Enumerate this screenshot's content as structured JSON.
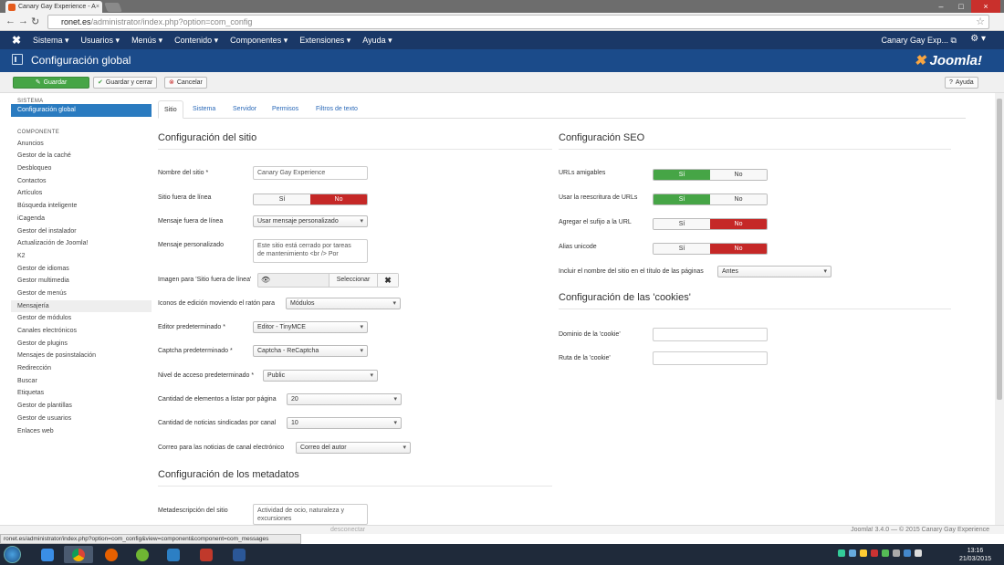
{
  "browser": {
    "tab_title": "Canary Gay Experience - A",
    "url_domain": "ronet.es",
    "url_path": "/administrator/index.php?option=com_config",
    "status_url": "ronet.es/administrator/index.php?option=com_config&view=component&component=com_messages"
  },
  "topnav": {
    "items": [
      "Sistema ▾",
      "Usuarios ▾",
      "Menús ▾",
      "Contenido ▾",
      "Componentes ▾",
      "Extensiones ▾",
      "Ayuda ▾"
    ],
    "site_name": "Canary Gay Exp... ⧉"
  },
  "header": {
    "title": "Configuración global",
    "brand": "Joomla!"
  },
  "toolbar": {
    "save": "Guardar",
    "save_close": "Guardar y cerrar",
    "cancel": "Cancelar",
    "help": "Ayuda"
  },
  "sidebar": {
    "system_heading": "SISTEMA",
    "system_item": "Configuración global",
    "component_heading": "COMPONENTE",
    "items": [
      "Anuncios",
      "Gestor de la caché",
      "Desbloqueo",
      "Contactos",
      "Artículos",
      "Búsqueda inteligente",
      "iCagenda",
      "Gestor del instalador",
      "Actualización de Joomla!",
      "K2",
      "Gestor de idiomas",
      "Gestor multimedia",
      "Gestor de menús",
      "Mensajería",
      "Gestor de módulos",
      "Canales electrónicos",
      "Gestor de plugins",
      "Mensajes de posinstalación",
      "Redirección",
      "Buscar",
      "Etiquetas",
      "Gestor de plantillas",
      "Gestor de usuarios",
      "Enlaces web"
    ]
  },
  "tabs": [
    "Sitio",
    "Sistema",
    "Servidor",
    "Permisos",
    "Filtros de texto"
  ],
  "site": {
    "heading": "Configuración del sitio",
    "site_name_label": "Nombre del sitio *",
    "site_name_value": "Canary Gay Experience",
    "offline_label": "Sitio fuera de línea",
    "offline_msg_label": "Mensaje fuera de línea",
    "offline_msg_value": "Usar mensaje personalizado",
    "custom_msg_label": "Mensaje personalizado",
    "custom_msg_value": "Este sitio está cerrado por tareas de mantenimiento <br /> Por",
    "offline_image_label": "Imagen para 'Sitio fuera de línea'",
    "select_btn": "Seleccionar",
    "edit_icons_label": "Iconos de edición moviendo el ratón para",
    "edit_icons_value": "Módulos",
    "editor_label": "Editor predeterminado *",
    "editor_value": "Editor - TinyMCE",
    "captcha_label": "Captcha predeterminado *",
    "captcha_value": "Captcha - ReCaptcha",
    "access_label": "Nivel de acceso predeterminado *",
    "access_value": "Public",
    "list_limit_label": "Cantidad de elementos a listar por página",
    "list_limit_value": "20",
    "feed_limit_label": "Cantidad de noticias sindicadas por canal",
    "feed_limit_value": "10",
    "feed_email_label": "Correo para las noticias de canal electrónico",
    "feed_email_value": "Correo del autor",
    "yes": "Sí",
    "no": "No"
  },
  "meta": {
    "heading": "Configuración de los metadatos",
    "desc_label": "Metadescripción del sitio",
    "desc_value": "Actividad de ocio, naturaleza y excursiones"
  },
  "seo": {
    "heading": "Configuración SEO",
    "sef_label": "URLs amigables",
    "rewrite_label": "Usar la reescritura de URLs",
    "suffix_label": "Agregar el sufijo a la URL",
    "unicode_label": "Alias unicode",
    "sitename_label": "Incluir el nombre del sitio en el título de las páginas",
    "sitename_value": "Antes",
    "yes": "Sí",
    "no": "No"
  },
  "cookies": {
    "heading": "Configuración de las 'cookies'",
    "domain_label": "Dominio de la 'cookie'",
    "path_label": "Ruta de la 'cookie'"
  },
  "footer": {
    "copyright": "Joomla! 3.4.0 — © 2015 Canary Gay Experience",
    "ghost": "desconectar"
  },
  "clock": {
    "time": "13:16",
    "date": "21/03/2015"
  },
  "colors": {
    "navbar": "#1a3867",
    "header": "#1b4b8a",
    "save_green": "#46a546",
    "no_red": "#c52827",
    "active_blue": "#2a7bc0"
  }
}
